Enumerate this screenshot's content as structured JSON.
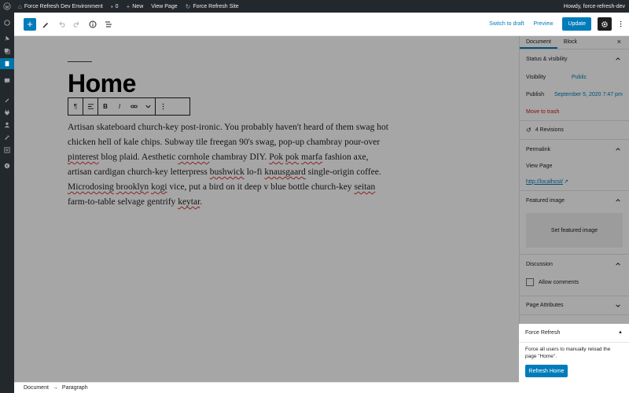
{
  "adminbar": {
    "site_name": "Force Refresh Dev Environment",
    "comments_count": "0",
    "new_label": "New",
    "view_page": "View Page",
    "force_refresh_site": "Force Refresh Site",
    "howdy": "Howdy, force-refresh-dev"
  },
  "header": {
    "switch_to_draft": "Switch to draft",
    "preview": "Preview",
    "update": "Update"
  },
  "post": {
    "title": "Home",
    "paragraph": [
      {
        "t": "Artisan skateboard church-key post-ironic. You probably haven't heard of them swag hot chicken hell of kale chips. Subway tile freegan 90's swag, pop-up chambray pour-over "
      },
      {
        "t": "pinterest",
        "sp": true
      },
      {
        "t": " blog plaid. Aesthetic "
      },
      {
        "t": "cornhole",
        "sp": true
      },
      {
        "t": " chambray DIY. "
      },
      {
        "t": "Pok",
        "sp": true
      },
      {
        "t": " "
      },
      {
        "t": "pok",
        "sp": true
      },
      {
        "t": " "
      },
      {
        "t": "marfa",
        "sp": true
      },
      {
        "t": " fashion axe, artisan cardigan church-key letterpress "
      },
      {
        "t": "bushwick",
        "sp": true
      },
      {
        "t": " lo-fi "
      },
      {
        "t": "knausgaard",
        "sp": true
      },
      {
        "t": " single-origin coffee. "
      },
      {
        "t": "Microdosing",
        "sp": true
      },
      {
        "t": " "
      },
      {
        "t": "brooklyn",
        "sp": true
      },
      {
        "t": " "
      },
      {
        "t": "kogi",
        "sp": true
      },
      {
        "t": " vice, put a bird on it deep v blue bottle church-key "
      },
      {
        "t": "seitan",
        "sp": true
      },
      {
        "t": " farm-to-table selvage gentrify "
      },
      {
        "t": "keytar",
        "sp": true
      },
      {
        "t": "."
      }
    ]
  },
  "footer": {
    "crumb1": "Document",
    "arrow": "→",
    "crumb2": "Paragraph"
  },
  "sidebar": {
    "tab_document": "Document",
    "tab_block": "Block",
    "close": "×",
    "status_visibility": "Status & visibility",
    "visibility_label": "Visibility",
    "visibility_value": "Public",
    "publish_label": "Publish",
    "publish_value": "September 5, 2020 7:47 pm",
    "move_to_trash": "Move to trash",
    "revisions": "4 Revisions",
    "permalink": "Permalink",
    "view_page": "View Page",
    "permalink_url": "http://localhost/",
    "featured_image": "Featured image",
    "set_featured": "Set featured image",
    "discussion": "Discussion",
    "allow_comments": "Allow comments",
    "page_attributes": "Page Attributes",
    "force_refresh": "Force Refresh",
    "force_refresh_triangle": "▲",
    "force_refresh_desc": "Force all users to manually reload the page \"Home\".",
    "refresh_button": "Refresh Home"
  },
  "colors": {
    "accent": "#007cba",
    "admin_bar": "#23282d",
    "trash": "#cc1818"
  }
}
